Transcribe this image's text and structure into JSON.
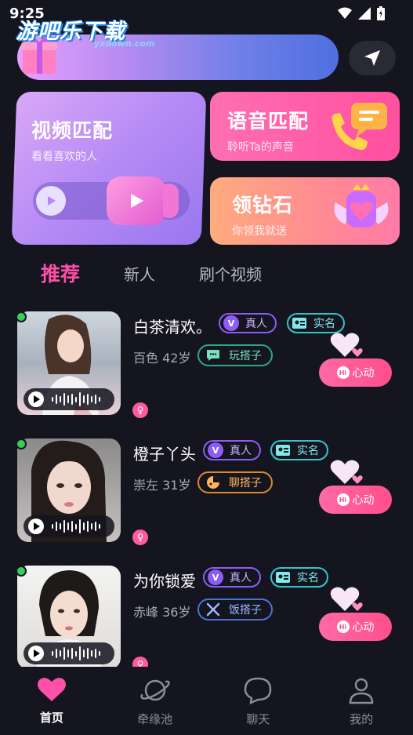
{
  "status_bar": {
    "time": "9:25"
  },
  "watermark": {
    "text": "游吧乐下载",
    "sub": "yxdown.com"
  },
  "cards": {
    "video": {
      "title": "视频匹配",
      "subtitle": "看看喜欢的人"
    },
    "voice": {
      "title": "语音匹配",
      "subtitle": "聆听Ta的声音"
    },
    "diamond": {
      "title": "领钻石",
      "subtitle": "你领我就送"
    }
  },
  "tabs": [
    {
      "label": "推荐",
      "active": true
    },
    {
      "label": "新人",
      "active": false
    },
    {
      "label": "刷个视频",
      "active": false
    }
  ],
  "badges": {
    "real": "真人",
    "verified": "实名",
    "real_icon": "V"
  },
  "like_label": "心动",
  "like_icon_text": "Hi",
  "users": [
    {
      "name": "白茶清欢。",
      "location": "百色",
      "age": "42岁",
      "tag": "玩搭子",
      "tag_icon": "chat-icon",
      "tag_color": "green",
      "online": true
    },
    {
      "name": "橙子丫头",
      "location": "崇左",
      "age": "31岁",
      "tag": "聊搭子",
      "tag_icon": "pizza-icon",
      "tag_color": "orange",
      "online": true
    },
    {
      "name": "为你锁爱",
      "location": "赤峰",
      "age": "36岁",
      "tag": "饭搭子",
      "tag_icon": "utensils-icon",
      "tag_color": "blue",
      "online": true
    }
  ],
  "nav": [
    {
      "label": "首页",
      "icon": "home-heart-icon",
      "active": true
    },
    {
      "label": "牵缘池",
      "icon": "planet-icon",
      "active": false
    },
    {
      "label": "聊天",
      "icon": "chat-bubble-icon",
      "active": false
    },
    {
      "label": "我的",
      "icon": "profile-icon",
      "active": false
    }
  ],
  "colors": {
    "accent": "#ff4fa8",
    "background": "#151520",
    "online": "#35d05b"
  }
}
